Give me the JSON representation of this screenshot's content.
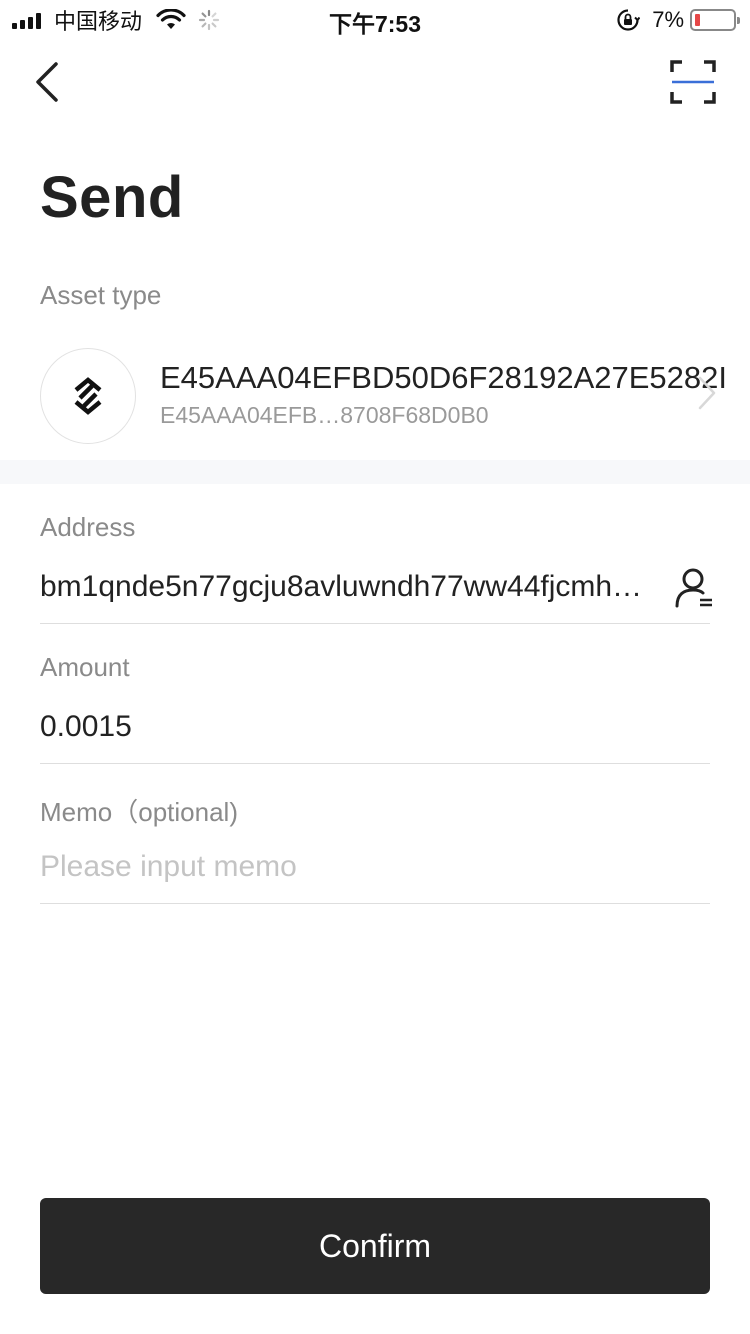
{
  "status_bar": {
    "carrier": "中国移动",
    "time": "下午7:53",
    "battery_percent": "7%",
    "battery_level": 0.07,
    "battery_color": "#e64848"
  },
  "nav": {
    "back_icon": "chevron-left-icon",
    "scan_icon": "scan-icon"
  },
  "page": {
    "title": "Send"
  },
  "asset": {
    "label": "Asset type",
    "name": "E45AAA04EFBD50D6F28192A27E5282I",
    "id": "E45AAA04EFB…8708F68D0B0",
    "logo_icon": "bytom-logo-icon"
  },
  "address": {
    "label": "Address",
    "value": "bm1qnde5n77gcju8avluwndh77ww44fjcmh…",
    "contact_icon": "contacts-icon"
  },
  "amount": {
    "label": "Amount",
    "value": "0.0015"
  },
  "memo": {
    "label": "Memo（optional)",
    "placeholder": "Please input memo",
    "value": ""
  },
  "confirm": {
    "label": "Confirm",
    "background": "#282828"
  }
}
